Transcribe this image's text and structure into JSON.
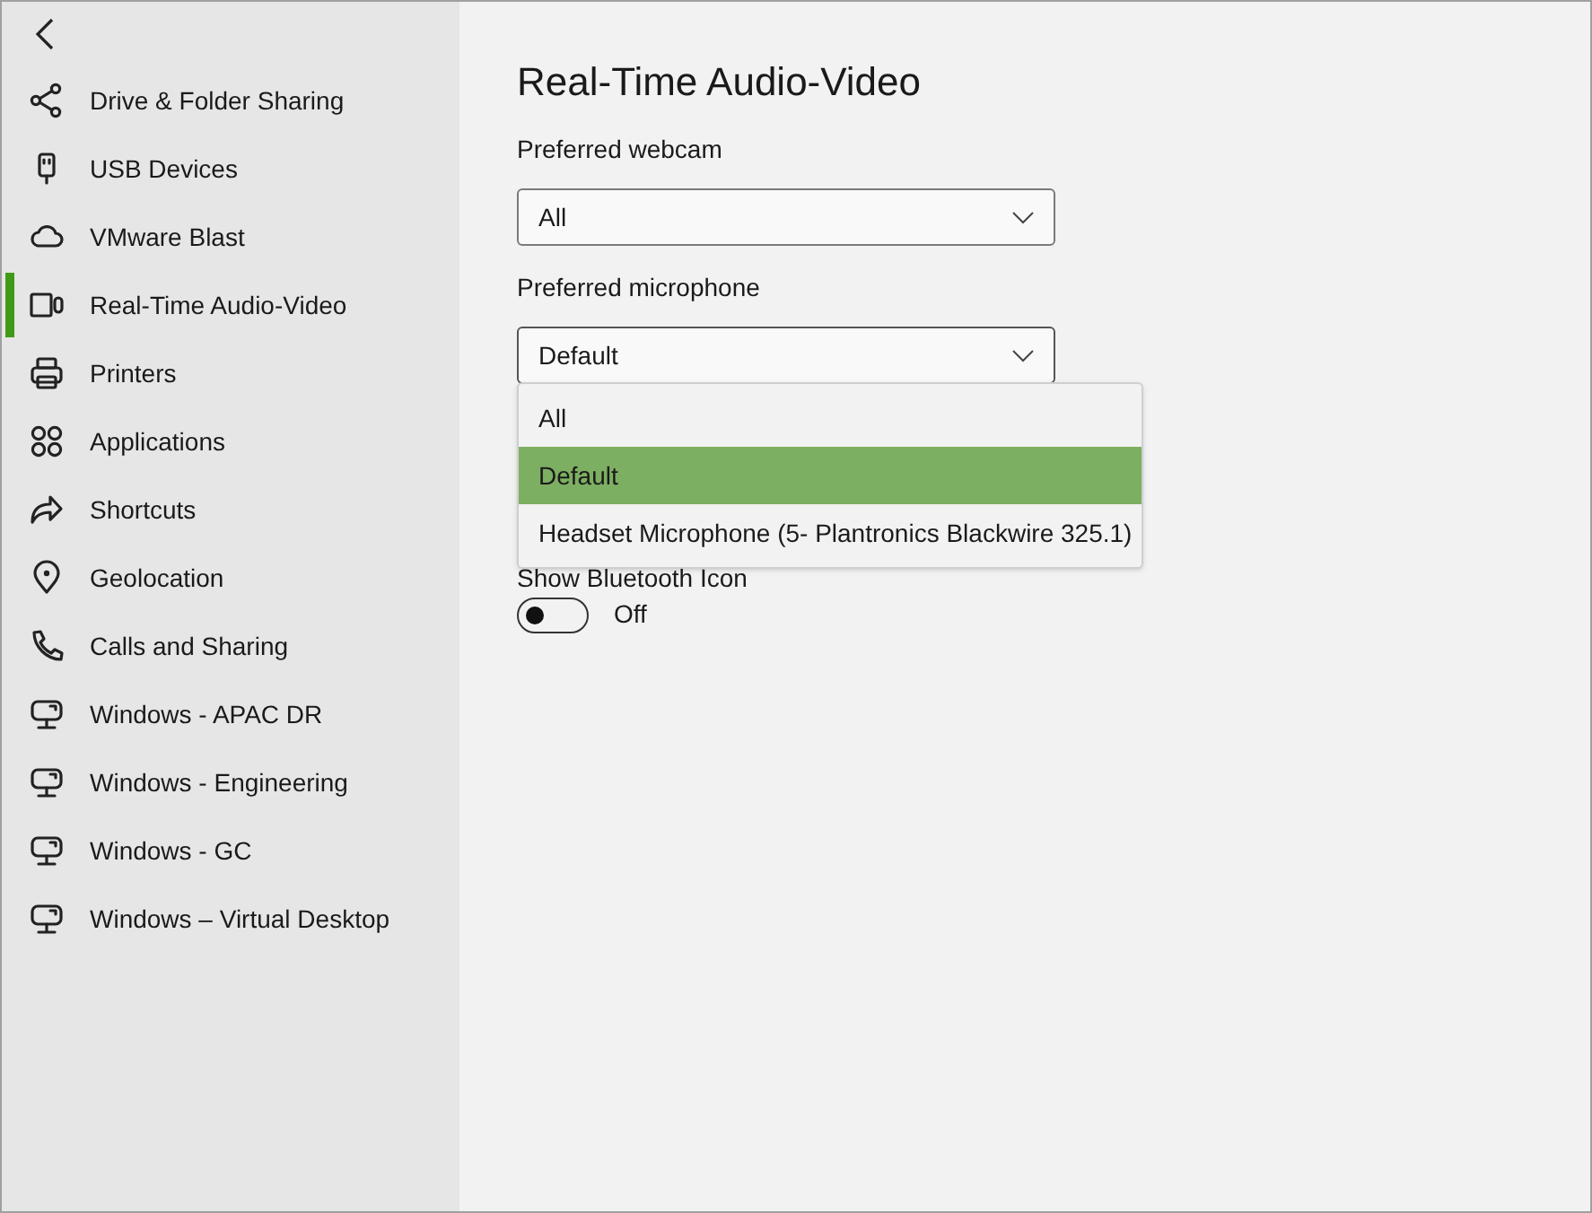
{
  "sidebar": {
    "items": [
      {
        "label": "Drive & Folder Sharing",
        "kind": "share",
        "selected": false
      },
      {
        "label": "USB Devices",
        "kind": "usb",
        "selected": false
      },
      {
        "label": "VMware Blast",
        "kind": "cloud",
        "selected": false
      },
      {
        "label": "Real-Time Audio-Video",
        "kind": "camera",
        "selected": true
      },
      {
        "label": "Printers",
        "kind": "printer",
        "selected": false
      },
      {
        "label": "Applications",
        "kind": "apps",
        "selected": false
      },
      {
        "label": "Shortcuts",
        "kind": "shortcut",
        "selected": false
      },
      {
        "label": "Geolocation",
        "kind": "location",
        "selected": false
      },
      {
        "label": "Calls and Sharing",
        "kind": "phone",
        "selected": false
      },
      {
        "label": "Windows - APAC DR",
        "kind": "desktop",
        "selected": false
      },
      {
        "label": "Windows - Engineering",
        "kind": "desktop",
        "selected": false
      },
      {
        "label": "Windows - GC",
        "kind": "desktop",
        "selected": false
      },
      {
        "label": "Windows – Virtual Desktop",
        "kind": "desktop",
        "selected": false
      }
    ]
  },
  "content": {
    "title": "Real-Time Audio-Video",
    "webcam": {
      "label": "Preferred webcam",
      "value": "All"
    },
    "microphone": {
      "label": "Preferred microphone",
      "value": "Default",
      "expanded": true,
      "options": [
        {
          "label": "All",
          "selected": false
        },
        {
          "label": "Default",
          "selected": true
        },
        {
          "label": "Headset Microphone (5- Plantronics Blackwire 325.1)",
          "selected": false
        }
      ]
    },
    "bluetooth": {
      "label": "Show Bluetooth Icon",
      "on": false,
      "state_text": "Off"
    }
  }
}
